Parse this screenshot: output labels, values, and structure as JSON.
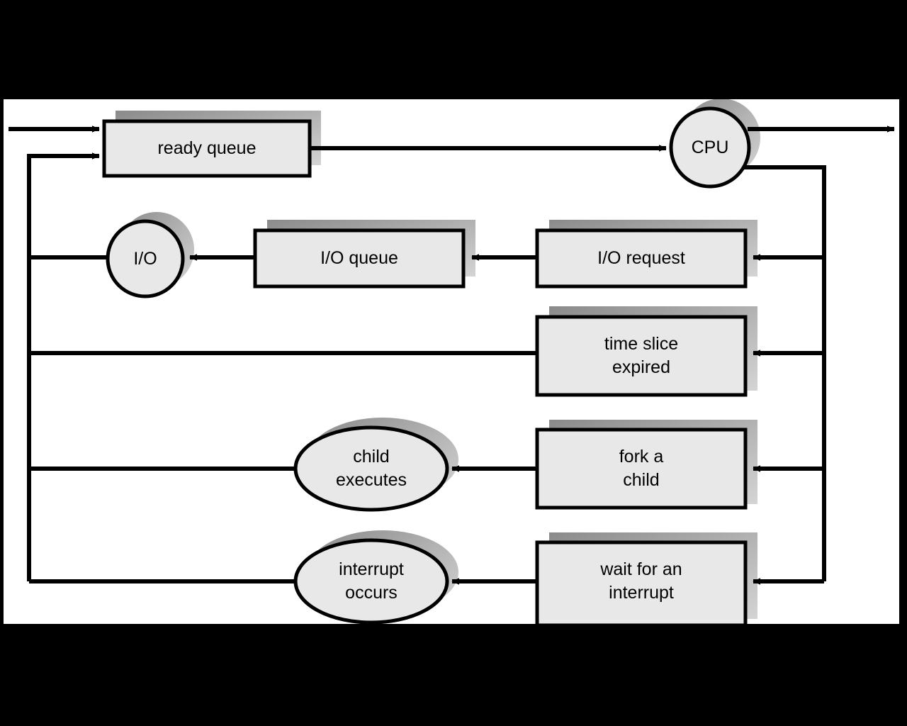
{
  "figure": {
    "kind": "process-scheduling-queueing-diagram",
    "background_color": "#000000",
    "panel_color": "#ffffff",
    "node_fill": "#e8e8e8",
    "node_stroke": "#000000",
    "shadow_dark": "#888888",
    "shadow_light": "#cccccc"
  },
  "nodes": {
    "ready_queue": {
      "label": "ready queue",
      "shape": "rect"
    },
    "cpu": {
      "label": "CPU",
      "shape": "circle"
    },
    "io": {
      "label": "I/O",
      "shape": "circle"
    },
    "io_queue": {
      "label": "I/O queue",
      "shape": "rect"
    },
    "io_request": {
      "label": "I/O request",
      "shape": "rect"
    },
    "time_slice_expired": {
      "label": "time slice\nexpired",
      "shape": "rect"
    },
    "fork_a_child": {
      "label": "fork a\nchild",
      "shape": "rect"
    },
    "child_executes": {
      "label": "child\nexecutes",
      "shape": "ellipse"
    },
    "wait_for_an_interrupt": {
      "label": "wait for an\ninterrupt",
      "shape": "rect"
    },
    "interrupt_occurs": {
      "label": "interrupt\noccurs",
      "shape": "ellipse"
    }
  },
  "edges": [
    {
      "name": "entry-to-ready-queue",
      "from": "entry",
      "to": "ready_queue"
    },
    {
      "name": "ready-queue-to-cpu",
      "from": "ready_queue",
      "to": "cpu"
    },
    {
      "name": "cpu-to-exit",
      "from": "cpu",
      "to": "exit"
    },
    {
      "name": "cpu-to-io-request",
      "from": "cpu",
      "to": "io_request"
    },
    {
      "name": "io-request-to-io-queue",
      "from": "io_request",
      "to": "io_queue"
    },
    {
      "name": "io-queue-to-io",
      "from": "io_queue",
      "to": "io"
    },
    {
      "name": "io-to-ready-queue",
      "from": "io",
      "to": "ready_queue"
    },
    {
      "name": "cpu-to-time-slice-expired",
      "from": "cpu",
      "to": "time_slice_expired"
    },
    {
      "name": "time-slice-expired-to-ready-queue",
      "from": "time_slice_expired",
      "to": "ready_queue"
    },
    {
      "name": "cpu-to-fork-a-child",
      "from": "cpu",
      "to": "fork_a_child"
    },
    {
      "name": "fork-a-child-to-child-executes",
      "from": "fork_a_child",
      "to": "child_executes"
    },
    {
      "name": "child-executes-to-ready-queue",
      "from": "child_executes",
      "to": "ready_queue"
    },
    {
      "name": "cpu-to-wait-for-an-interrupt",
      "from": "cpu",
      "to": "wait_for_an_interrupt"
    },
    {
      "name": "wait-for-an-interrupt-to-interrupt-occurs",
      "from": "wait_for_an_interrupt",
      "to": "interrupt_occurs"
    },
    {
      "name": "interrupt-occurs-to-ready-queue",
      "from": "interrupt_occurs",
      "to": "ready_queue"
    }
  ]
}
